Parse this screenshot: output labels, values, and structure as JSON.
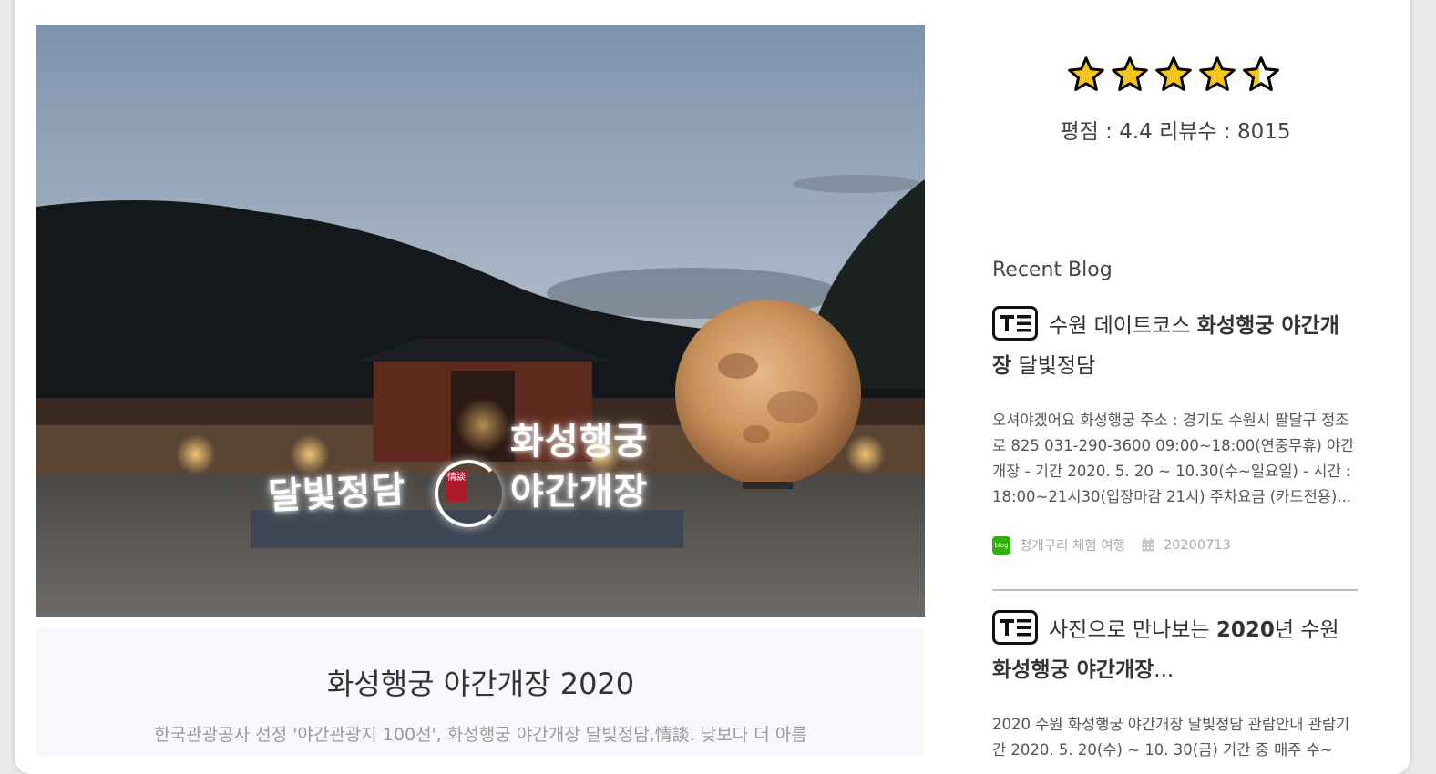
{
  "hero": {
    "sign_left": "달빛정담",
    "sign_right_top": "화성행궁",
    "sign_right_bottom": "야간개장",
    "seal": "情談"
  },
  "caption": {
    "title": "화성행궁 야간개장 2020",
    "description": "한국관광공사 선정 '야간관광지 100선', 화성행궁 야간개장 달빛정담,情談. 낮보다 더 아름"
  },
  "rating": {
    "stars_filled": 4,
    "stars_total": 5,
    "text": "평점 : 4.4 리뷰수 : 8015",
    "star_color": "#f5c518"
  },
  "recent_blog": {
    "title": "Recent Blog",
    "posts": [
      {
        "title_prefix": "수원 데이트코스 ",
        "title_bold": "화성행궁 야간개장",
        "title_suffix": " 달빛정담",
        "excerpt": "오셔야겠어요 화성행궁     주소 : 경기도 수원시 팔달구 정조로 825     031-290-3600     09:00~18:00(연중무휴)     야간개장 - 기간 2020. 5. 20 ~ 10.30(수~일요일) - 시간 : 18:00~21시30(입장마감 21시)     주차요금 (카드전용)...",
        "blog_name": "청개구리 체험 여행",
        "date": "20200713",
        "badge_label": "blog"
      },
      {
        "title_prefix": "사진으로 만나보는 ",
        "title_bold": "2020",
        "title_suffix": "년 수원 ",
        "title_bold2": "화성행궁 야간개장",
        "title_end": "...",
        "excerpt": "2020 수원 화성행궁 야간개장 달빛정담 관람안내 관람기간 2020. 5. 20(수) ~ 10. 30(금) 기간 중 매주 수~"
      }
    ]
  }
}
